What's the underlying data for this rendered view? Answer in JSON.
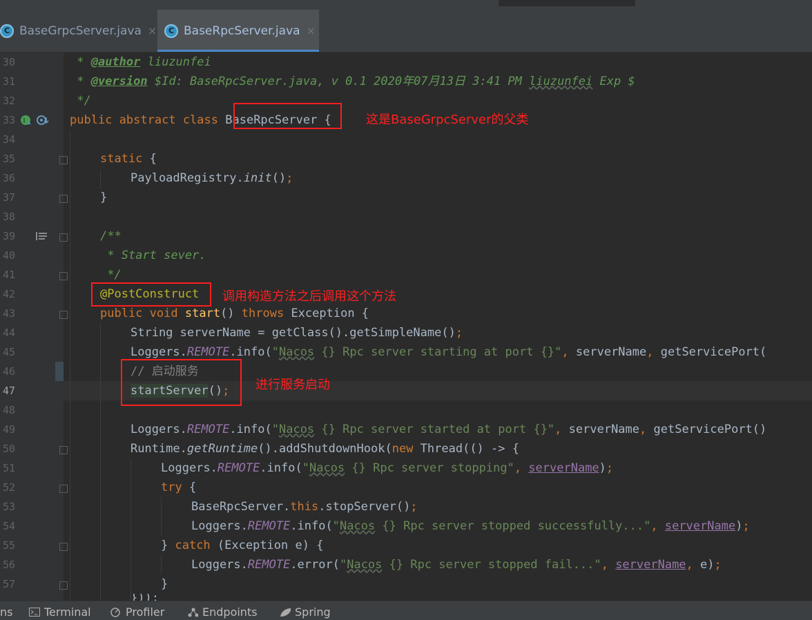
{
  "tabs": [
    {
      "label": "BaseGrpcServer.java",
      "active": false
    },
    {
      "label": "BaseRpcServer.java",
      "active": true
    }
  ],
  "tab_icon_text": "C",
  "close_glyph": "×",
  "line_numbers": [
    "30",
    "31",
    "32",
    "33",
    "34",
    "35",
    "36",
    "37",
    "38",
    "39",
    "40",
    "41",
    "42",
    "43",
    "44",
    "45",
    "46",
    "47",
    "48",
    "49",
    "50",
    "51",
    "52",
    "53",
    "54",
    "55",
    "56",
    "57"
  ],
  "code": {
    "l30": {
      "star": " * ",
      "tag": "@author",
      "rest": " liuzunfei"
    },
    "l31": {
      "star": " * ",
      "tag": "@version",
      "pre": " $Id: BaseRpcServer.java, v 0.1 2020年07月13日 3:41 PM ",
      "name": "liuzunfei",
      "post": " Exp $"
    },
    "l32": " */",
    "l33": {
      "public": "public",
      "abstract": "abstract",
      "class": "class",
      "name": "BaseRpcServer",
      "brace": " {"
    },
    "l35": {
      "static": "static",
      "brace": " {"
    },
    "l36": {
      "cls": "PayloadRegistry.",
      "method": "init",
      "rest": "()",
      "semi": ";"
    },
    "l37": "}",
    "l39": "/**",
    "l40": " * Start sever.",
    "l41": " */",
    "l42": "@PostConstruct",
    "l43": {
      "public": "public",
      "void": "void",
      "method": "start",
      "paren": "() ",
      "throws": "throws",
      "rest": " Exception {"
    },
    "l44": {
      "text": "String serverName = getClass().getSimpleName()",
      "semi": ";"
    },
    "l45": {
      "pre": "Loggers.",
      "field": "REMOTE",
      "call": ".info(",
      "q": "\"",
      "nacos": "Nacos",
      "str": " {} Rpc server starting at port {}\"",
      "comma": ",",
      "rest": " serverName",
      "comma2": ",",
      "tail": " getServicePort("
    },
    "l46": "// 启动服务",
    "l47": {
      "call": "startServer",
      "rest": "()",
      "semi": ";"
    },
    "l49": {
      "pre": "Loggers.",
      "field": "REMOTE",
      "call": ".info(",
      "q": "\"",
      "nacos": "Nacos",
      "str": " {} Rpc server started at port {}\"",
      "comma": ",",
      "rest": " serverName",
      "comma2": ",",
      "tail": " getServicePort()"
    },
    "l50": {
      "pre": "Runtime.",
      "method": "getRuntime",
      "mid": "().addShutdownHook(",
      "new": "new",
      "rest": " Thread(() -> {"
    },
    "l51": {
      "pre": "Loggers.",
      "field": "REMOTE",
      "call": ".info(",
      "q": "\"",
      "nacos": "Nacos",
      "str": " {} Rpc server stopping\"",
      "comma": ",",
      "sp": " ",
      "var": "serverName",
      "end": ")",
      "semi": ";"
    },
    "l52": {
      "try": "try",
      "brace": " {"
    },
    "l53": {
      "cls": "BaseRpcServer.",
      "this": "this",
      "rest": ".stopServer()",
      "semi": ";"
    },
    "l54": {
      "pre": "Loggers.",
      "field": "REMOTE",
      "call": ".info(",
      "q": "\"",
      "nacos": "Nacos",
      "str": " {} Rpc server stopped successfully...\"",
      "comma": ",",
      "sp": " ",
      "var": "serverName",
      "end": ")",
      "semi": ";"
    },
    "l55": {
      "close": "} ",
      "catch": "catch",
      "rest": " (Exception e) {"
    },
    "l56": {
      "pre": "Loggers.",
      "field": "REMOTE",
      "call": ".error(",
      "q": "\"",
      "nacos": "Nacos",
      "str": " {} Rpc server stopped fail...\"",
      "comma": ",",
      "sp": " ",
      "var": "serverName",
      "comma2": ",",
      "rest": " e)",
      "semi": ";"
    },
    "l57": "}",
    "l58": "}));"
  },
  "annotations": {
    "note1": "这是BaseGrpcServer的父类",
    "note2": "调用构造方法之后调用这个方法",
    "note3": "进行服务启动",
    "box_color": "#ff1e1e"
  },
  "statusbar": {
    "left_partial": "ns",
    "items": [
      {
        "label": "Terminal",
        "icon": "terminal-icon"
      },
      {
        "label": "Profiler",
        "icon": "profiler-icon"
      },
      {
        "label": "Endpoints",
        "icon": "endpoints-icon"
      },
      {
        "label": "Spring",
        "icon": "spring-icon"
      }
    ]
  },
  "colors": {
    "background": "#2b2b2b",
    "keyword": "#cc7832",
    "string": "#6a8759",
    "doc_comment": "#629755",
    "annotation": "#bbb529",
    "field": "#9876aa",
    "method_decl": "#ffc66d",
    "active_tab_accent": "#4a88c7"
  }
}
